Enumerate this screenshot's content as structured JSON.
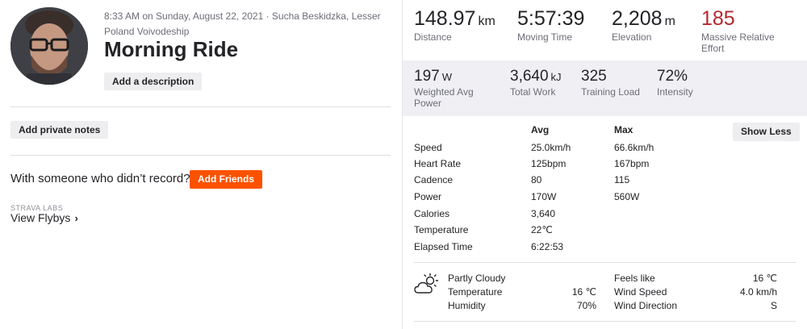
{
  "activity": {
    "meta": "8:33 AM on Sunday, August 22, 2021 · Sucha Beskidzka, Lesser Poland Voivodeship",
    "title": "Morning Ride",
    "add_description": "Add a description",
    "add_private_notes": "Add private notes",
    "friends_prompt": "With someone who didn’t record?",
    "add_friends": "Add Friends",
    "labs_label": "STRAVA LABS",
    "flybys": "View Flybys",
    "flybys_chevron": "›"
  },
  "primary_stats": [
    {
      "value": "148.97",
      "unit": "km",
      "label": "Distance"
    },
    {
      "value": "5:57:39",
      "unit": "",
      "label": "Moving Time"
    },
    {
      "value": "2,208",
      "unit": "m",
      "label": "Elevation"
    },
    {
      "value": "185",
      "unit": "",
      "label": "Massive Relative Effort"
    }
  ],
  "secondary_stats": [
    {
      "value": "197",
      "unit": "W",
      "label": "Weighted Avg Power"
    },
    {
      "value": "3,640",
      "unit": "kJ",
      "label": "Total Work"
    },
    {
      "value": "325",
      "unit": "",
      "label": "Training Load"
    },
    {
      "value": "72%",
      "unit": "",
      "label": "Intensity"
    }
  ],
  "details": {
    "avg_header": "Avg",
    "max_header": "Max",
    "show_less": "Show Less",
    "rows": [
      {
        "label": "Speed",
        "avg": "25.0km/h",
        "max": "66.6km/h"
      },
      {
        "label": "Heart Rate",
        "avg": "125bpm",
        "max": "167bpm"
      },
      {
        "label": "Cadence",
        "avg": "80",
        "max": "115"
      },
      {
        "label": "Power",
        "avg": "170W",
        "max": "560W"
      },
      {
        "label": "Calories",
        "avg": "3,640",
        "max": ""
      },
      {
        "label": "Temperature",
        "avg": "22℃",
        "max": ""
      },
      {
        "label": "Elapsed Time",
        "avg": "6:22:53",
        "max": ""
      }
    ]
  },
  "weather": {
    "icon": "partly-cloudy-icon",
    "condition": "Partly Cloudy",
    "temperature_label": "Temperature",
    "temperature_value": "16 ℃",
    "humidity_label": "Humidity",
    "humidity_value": "70%",
    "feels_like_label": "Feels like",
    "feels_like_value": "16 ℃",
    "wind_speed_label": "Wind Speed",
    "wind_speed_value": "4.0 km/h",
    "wind_direction_label": "Wind Direction",
    "wind_direction_value": "S"
  },
  "colors": {
    "accent": "#fc5200",
    "effort_red": "#b4272e"
  }
}
